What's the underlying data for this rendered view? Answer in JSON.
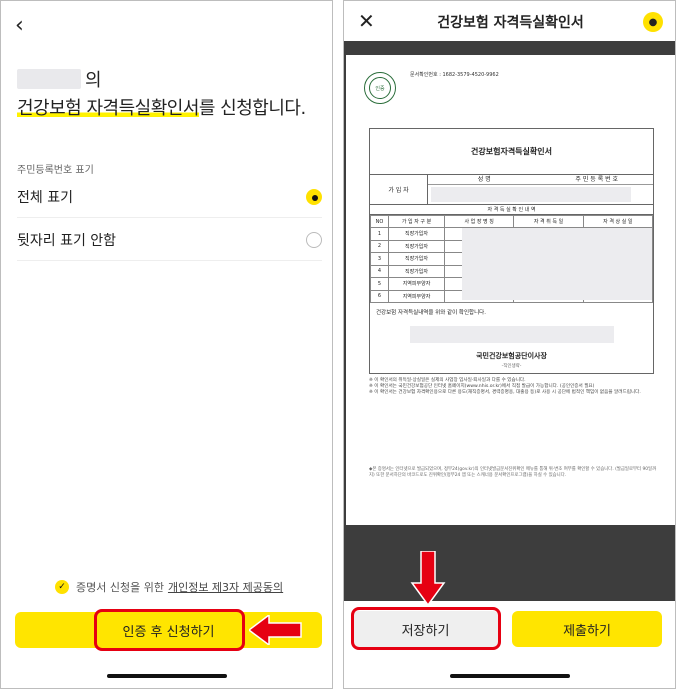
{
  "left": {
    "title_suffix": "의",
    "title_highlight": "건강보험 자격득실확인서",
    "title_rest": "를 신청합니다.",
    "section_label": "주민등록번호 표기",
    "options": [
      {
        "label": "전체 표기",
        "selected": true
      },
      {
        "label": "뒷자리 표기 안함",
        "selected": false
      }
    ],
    "consent_text": "증명서 신청을 위한",
    "consent_link": "개인정보 제3자 제공동의",
    "consent_checked": true,
    "apply_button": "인증 후 신청하기"
  },
  "right": {
    "title": "건강보험 자격득실확인서",
    "save_button": "저장하기",
    "submit_button": "제출하기",
    "doc": {
      "issue_no": "문서확인번호 : 1682-3579-4520-9962",
      "title": "건강보험자격득실확인서",
      "subscriber_label": "가 입 자",
      "name_header": "성 명",
      "rrn_header": "주 민 등 록 번 호",
      "detail_header": "자 격 득 실 확 인 내 역",
      "columns": [
        "NO",
        "가 입 자 구 분",
        "사 업 장 명 칭",
        "자 격 취 득 일",
        "자 격 상 실 일"
      ],
      "rows": [
        {
          "no": "1",
          "type": "직장가입자"
        },
        {
          "no": "2",
          "type": "직장가입자"
        },
        {
          "no": "3",
          "type": "직장가입자"
        },
        {
          "no": "4",
          "type": "직장가입자"
        },
        {
          "no": "5",
          "type": "지역피부양자"
        },
        {
          "no": "6",
          "type": "지역피부양자"
        }
      ],
      "confirm_text": "건강보험 자격득실내역을 위와 같이 확인합니다.",
      "org": "국민건강보험공단이사장",
      "sig": "-직인생략-",
      "note1": "※ 이 확인서의 취득일·상실일은 실제의 사업장 입사일·퇴사일과 다를 수 있습니다.",
      "note2": "※ 이 확인서는 국민건강보험공단 인터넷 홈페이지(www.nhis.or.kr)에서 직접 발급이 가능합니다. (공인인증서 필요)",
      "note3": "※ 이 확인서는 건강보험 자격확인용으로 다른 용도(재직증명서, 경력증명용, 대출용 등)로 사용 시 공단에 법적인 책임이 없음을 알려드립니다.",
      "footer": "◆본 증명서는 인터넷으로 발급되었으며, 정부24(gov.kr)의 인터넷발급문서진위확인 메뉴를 통해 위·변조 여부를 확인할 수 있습니다. (발급일로부터 90일까지) 또한 문서하단의 바코드로도 진위확인(정부24 앱 또는 스캐너용 문서확인프로그램)을 하실 수 있습니다."
    }
  }
}
